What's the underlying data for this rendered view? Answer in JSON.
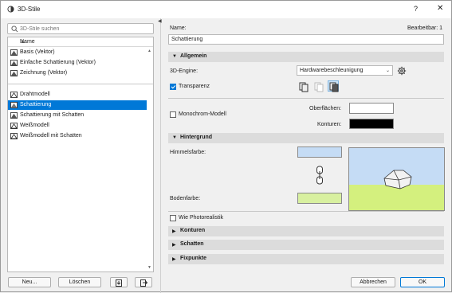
{
  "titlebar": {
    "title": "3D-Stile",
    "help": "?",
    "close": "✕"
  },
  "search": {
    "placeholder": "3D-Stile suchen"
  },
  "list": {
    "header": "Name",
    "items": [
      {
        "label": "Basis (Vektor)",
        "selected": false
      },
      {
        "label": "Einfache Schattierung (Vektor)",
        "selected": false
      },
      {
        "label": "Zeichnung (Vektor)",
        "selected": false
      },
      {
        "label": "Drahtmodell",
        "selected": false
      },
      {
        "label": "Schattierung",
        "selected": true
      },
      {
        "label": "Schattierung mit Schatten",
        "selected": false
      },
      {
        "label": "Weißmodell",
        "selected": false
      },
      {
        "label": "Weißmodell mit Schatten",
        "selected": false
      }
    ]
  },
  "left_buttons": {
    "new": "Neu...",
    "delete": "Löschen"
  },
  "name_field": {
    "label": "Name:",
    "value": "Schattierung",
    "editable_label": "Bearbeitbar: 1"
  },
  "sections": {
    "general": "Allgemein",
    "background": "Hintergrund",
    "contours": "Konturen",
    "shadows": "Schatten",
    "fixpoints": "Fixpunkte"
  },
  "general": {
    "engine_label": "3D-Engine:",
    "engine_value": "Hardwarebeschleunigung",
    "transparency_label": "Transparenz",
    "transparency_checked": true,
    "mono_label": "Monochrom-Modell",
    "mono_checked": false,
    "surfaces_label": "Oberflächen:",
    "contours_label": "Konturen:"
  },
  "background": {
    "sky_label": "Himmelsfarbe:",
    "ground_label": "Bodenfarbe:",
    "sky_color": "#c5dcf5",
    "ground_color": "#d8f0a0"
  },
  "photoreal": {
    "label": "Wie Photorealistik",
    "checked": false
  },
  "footer": {
    "cancel": "Abbrechen",
    "ok": "OK"
  },
  "colors": {
    "accent": "#0078d7",
    "contour_swatch": "#000000",
    "surface_swatch": "#ffffff"
  }
}
